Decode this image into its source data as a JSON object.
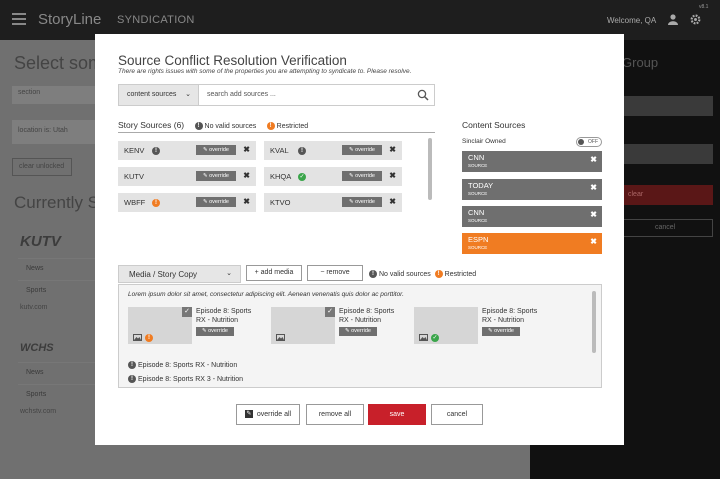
{
  "app": {
    "brand": "StoryLine",
    "section": "SYNDICATION",
    "welcome": "Welcome, QA",
    "version": "v8.1"
  },
  "background": {
    "heading": "Select som",
    "field_section": "section",
    "field_location": "location is: Utah",
    "clear_unlocked": "clear unlocked",
    "currently": "Currently S",
    "station1_logo": "KUTV",
    "station1_items": [
      "News",
      "Sports"
    ],
    "station1_url": "kutv.com",
    "station2_logo": "WCHS",
    "station2_items": [
      "News",
      "Sports"
    ],
    "station2_url": "wchstv.com",
    "right_group": "Group",
    "right_clear": "clear",
    "right_cancel": "cancel"
  },
  "modal": {
    "title": "Source Conflict Resolution Verification",
    "subtitle": "There are rights issues with some of the properties you are attempting to syndicate to. Please resolve.",
    "search_dropdown": "content sources",
    "search_placeholder": "search add sources ...",
    "story_sources_title": "Story Sources (6)",
    "legend_no_valid": "No valid sources",
    "legend_restricted": "Restricted",
    "override_label": "override",
    "sources": [
      {
        "name": "KENV",
        "status": "info"
      },
      {
        "name": "KVAL",
        "status": "info"
      },
      {
        "name": "KUTV",
        "status": "none"
      },
      {
        "name": "KHQA",
        "status": "ok"
      },
      {
        "name": "WBFF",
        "status": "warn"
      },
      {
        "name": "KTVO",
        "status": "none"
      }
    ],
    "content_sources_title": "Content Sources",
    "owner_label": "Sinclair Owned",
    "toggle_label": "OFF",
    "source_sublabel": "SOURCE",
    "content_sources": [
      {
        "name": "CNN",
        "active": false
      },
      {
        "name": "TODAY",
        "active": false
      },
      {
        "name": "CNN",
        "active": false
      },
      {
        "name": "ESPN",
        "active": true
      }
    ],
    "media_dropdown": "Media / Story Copy",
    "add_media": "+ add media",
    "remove": "− remove",
    "lorem": "Lorem ipsum dolor sit amet, consectetur adipiscing elit. Aenean venenatis quis dolor ac porttitor.",
    "media_cards": [
      {
        "title": "Episode 8: Sports RX - Nutrition",
        "checked": true,
        "status": "warn"
      },
      {
        "title": "Episode 8: Sports RX - Nutrition",
        "checked": true,
        "status": "none"
      },
      {
        "title": "Episode 8: Sports RX - Nutrition",
        "checked": false,
        "status": "ok"
      }
    ],
    "media_list": [
      "Episode 8: Sports RX - Nutrition",
      "Episode 8: Sports RX 3 - Nutrition"
    ],
    "footer": {
      "override_all": "override all",
      "remove_all": "remove all",
      "save": "save",
      "cancel": "cancel"
    }
  },
  "colors": {
    "accent": "#f07c22",
    "save": "#c8202a",
    "ok": "#3aa54a",
    "card_dark": "#6f6f6f"
  }
}
